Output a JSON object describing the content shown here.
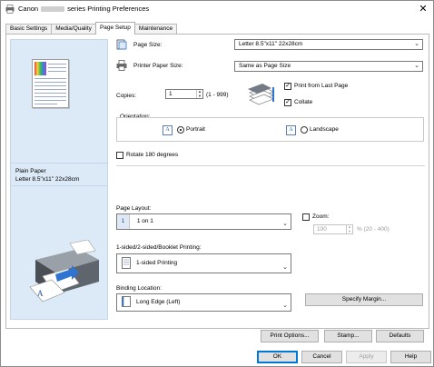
{
  "window": {
    "title_prefix": "Canon",
    "title_suffix": "series Printing Preferences",
    "close_glyph": "✕"
  },
  "tabs": [
    {
      "label": "Basic Settings",
      "active": false
    },
    {
      "label": "Media/Quality",
      "active": false
    },
    {
      "label": "Page Setup",
      "active": true
    },
    {
      "label": "Maintenance",
      "active": false
    }
  ],
  "preview": {
    "media_type": "Plain Paper",
    "paper_size": "Letter 8.5\"x11\" 22x28cm"
  },
  "page_size": {
    "label": "Page Size:",
    "value": "Letter 8.5\"x11\" 22x28cm"
  },
  "printer_paper_size": {
    "label": "Printer Paper Size:",
    "value": "Same as Page Size"
  },
  "copies": {
    "label": "Copies:",
    "value": "1",
    "range": "(1 - 999)"
  },
  "print_from_last_page": {
    "label": "Print from Last Page",
    "checked": true
  },
  "collate": {
    "label": "Collate",
    "checked": true
  },
  "orientation": {
    "label": "Orientation:",
    "portrait": {
      "label": "Portrait",
      "icon": "A",
      "selected": true
    },
    "landscape": {
      "label": "Landscape",
      "icon": "A",
      "selected": false
    }
  },
  "rotate_180": {
    "label": "Rotate 180 degrees",
    "checked": false
  },
  "page_layout": {
    "label": "Page Layout:",
    "value": "1 on 1",
    "icon": "1"
  },
  "zoom": {
    "label": "Zoom:",
    "checked": false,
    "value": "100",
    "range": "% (20 - 400)"
  },
  "duplex": {
    "label": "1-sided/2-sided/Booklet Printing:",
    "value": "1-sided Printing"
  },
  "binding": {
    "label": "Binding Location:",
    "value": "Long Edge (Left)"
  },
  "buttons": {
    "specify_margin": "Specify Margin...",
    "print_options": "Print Options...",
    "stamp": "Stamp...",
    "defaults": "Defaults",
    "ok": "OK",
    "cancel": "Cancel",
    "apply": "Apply",
    "help": "Help"
  },
  "check_glyph": "✓",
  "arrow_glyph": "⌄",
  "colors": {
    "preview_bg": "#dce9f7",
    "accent": "#0078d7"
  }
}
